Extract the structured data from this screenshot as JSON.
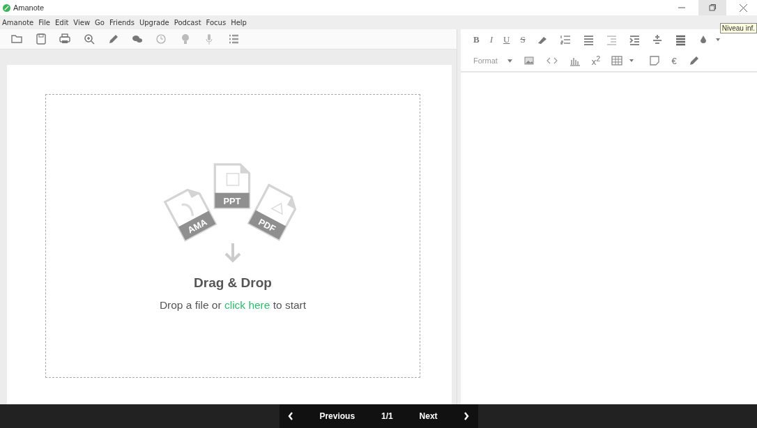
{
  "window": {
    "title": "Amanote",
    "tooltip": "Niveau inf."
  },
  "menu": [
    "Amanote",
    "File",
    "Edit",
    "View",
    "Go",
    "Friends",
    "Upgrade",
    "Podcast",
    "Focus",
    "Help"
  ],
  "editor_toolbar": {
    "text_buttons": [
      "B",
      "I",
      "U",
      "S"
    ],
    "format_dropdown": "Format",
    "superscript": "x$^{2}$",
    "currency": "€"
  },
  "dropzone": {
    "file_types": [
      "AMA",
      "PPT",
      "PDF"
    ],
    "heading": "Drag & Drop",
    "prompt_before": "Drop a file or",
    "link": "click here",
    "prompt_after": "to start"
  },
  "pager": {
    "previous": "Previous",
    "page": "1/1",
    "next": "Next"
  }
}
